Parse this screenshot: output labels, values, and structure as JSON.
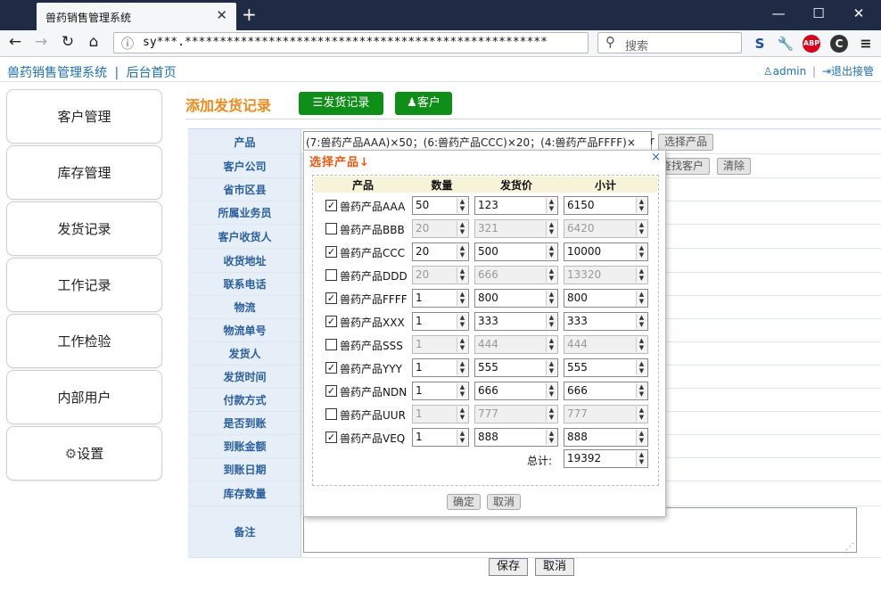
{
  "browser": {
    "tab_title": "兽药销售管理系统",
    "url": "sy***.****************************************************",
    "search_placeholder": "搜索",
    "ext_s": "S",
    "ext_abp": "ABP",
    "ext_c": "C"
  },
  "header": {
    "brand": "兽药销售管理系统",
    "separator": "|",
    "home": "后台首页",
    "user": "admin",
    "logout": "退出接管"
  },
  "sidebar": {
    "items": [
      "客户管理",
      "库存管理",
      "发货记录",
      "工作记录",
      "工作检验",
      "内部用户",
      "设置"
    ]
  },
  "main": {
    "title": "添加发货记录",
    "btn_records": "发货记录",
    "btn_customer": "客户",
    "labels": [
      "产品",
      "客户公司",
      "省市区县",
      "所属业务员",
      "客户收货人",
      "收货地址",
      "联系电话",
      "物流",
      "物流单号",
      "发货人",
      "发货时间",
      "付款方式",
      "是否到账",
      "到账金额",
      "到账日期",
      "库存数量",
      "备注"
    ],
    "product_value": "(7:兽药产品AAA)×50；(6:兽药产品CCC)×20；(4:兽药产品FFFF)×",
    "product_tail": "r",
    "select_product": "选择产品",
    "find_customer": "查找客户",
    "clear": "清除",
    "save": "保存",
    "cancel": "取消"
  },
  "popup": {
    "title": "选择产品↓",
    "close": "×",
    "headers": [
      "产品",
      "数量",
      "发货价",
      "小计"
    ],
    "rows": [
      {
        "checked": true,
        "name": "兽药产品AAA",
        "qty": "50",
        "price": "123",
        "subtotal": "6150"
      },
      {
        "checked": false,
        "name": "兽药产品BBB",
        "qty": "20",
        "price": "321",
        "subtotal": "6420"
      },
      {
        "checked": true,
        "name": "兽药产品CCC",
        "qty": "20",
        "price": "500",
        "subtotal": "10000"
      },
      {
        "checked": false,
        "name": "兽药产品DDD",
        "qty": "20",
        "price": "666",
        "subtotal": "13320"
      },
      {
        "checked": true,
        "name": "兽药产品FFFF",
        "qty": "1",
        "price": "800",
        "subtotal": "800"
      },
      {
        "checked": true,
        "name": "兽药产品XXX",
        "qty": "1",
        "price": "333",
        "subtotal": "333"
      },
      {
        "checked": false,
        "name": "兽药产品SSS",
        "qty": "1",
        "price": "444",
        "subtotal": "444"
      },
      {
        "checked": true,
        "name": "兽药产品YYY",
        "qty": "1",
        "price": "555",
        "subtotal": "555"
      },
      {
        "checked": true,
        "name": "兽药产品NDN",
        "qty": "1",
        "price": "666",
        "subtotal": "666"
      },
      {
        "checked": false,
        "name": "兽药产品UUR",
        "qty": "1",
        "price": "777",
        "subtotal": "777"
      },
      {
        "checked": true,
        "name": "兽药产品VEQ",
        "qty": "1",
        "price": "888",
        "subtotal": "888"
      }
    ],
    "total_label": "总计:",
    "total": "19392",
    "ok": "确定",
    "cancel": "取消"
  }
}
